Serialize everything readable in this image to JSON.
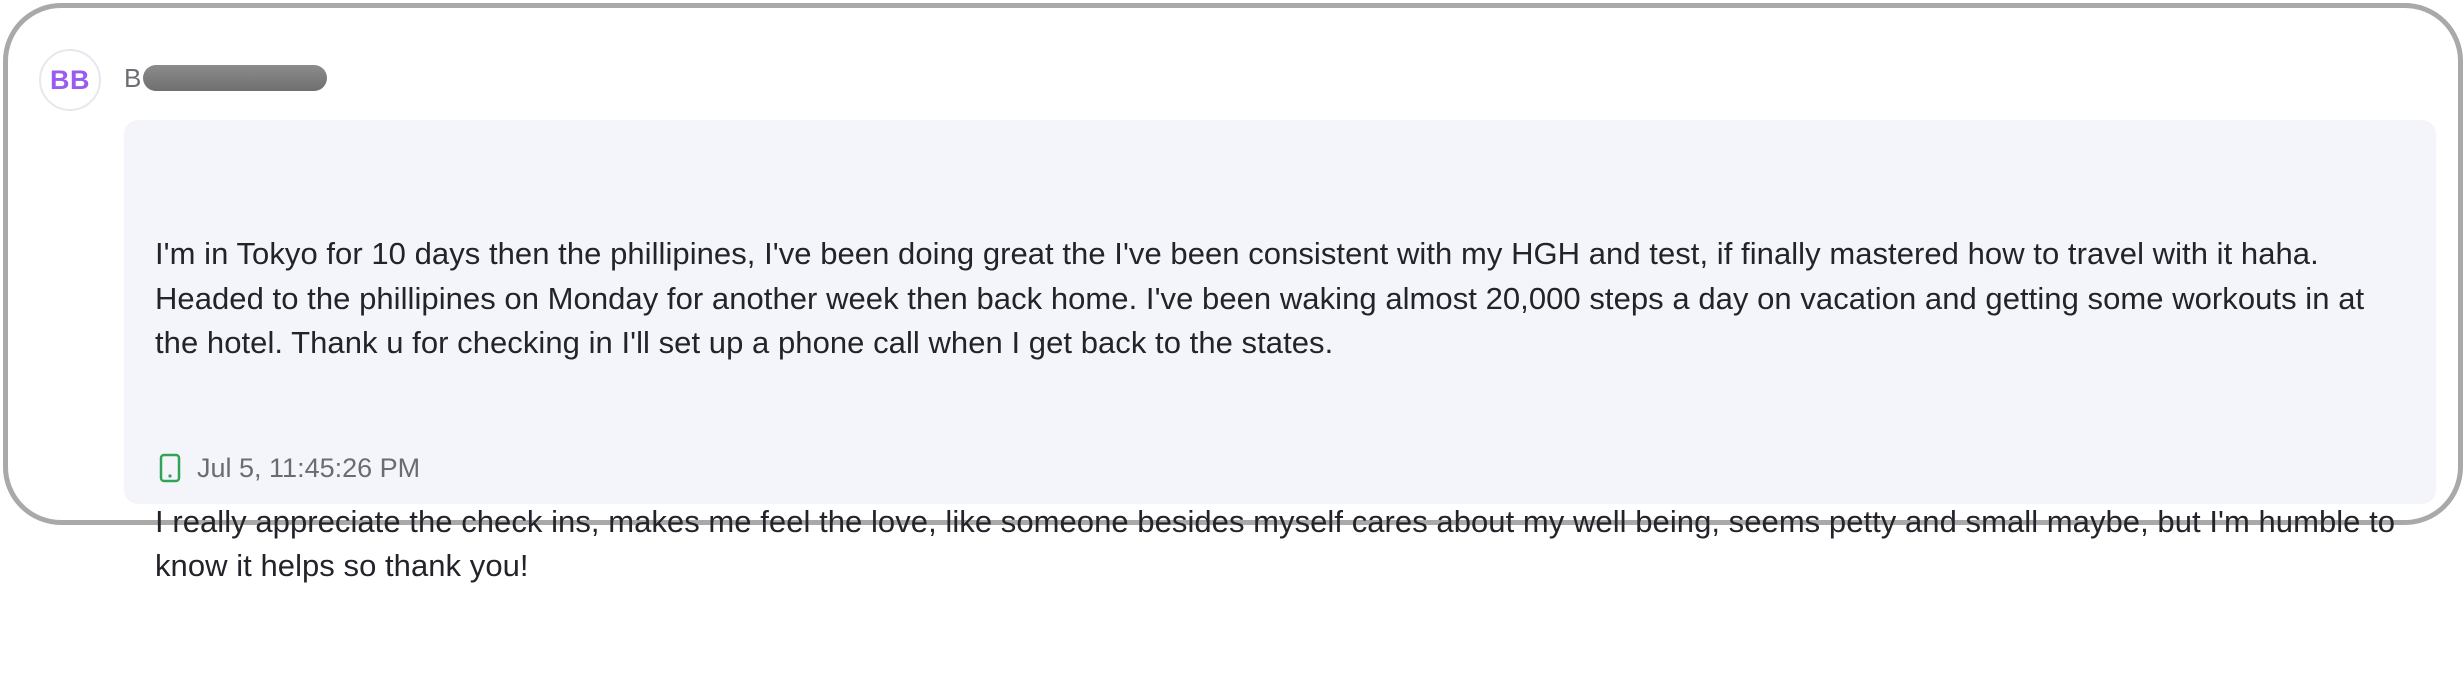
{
  "sender": {
    "initials": "BB",
    "name_visible": "B"
  },
  "message": {
    "paragraphs": [
      "I'm in Tokyo for 10 days then the phillipines, I've been doing great the I've been consistent with my HGH and test, if finally mastered how to travel with it haha. Headed to the phillipines on Monday for another week then back home. I've been waking almost 20,000 steps a day on vacation and getting some workouts in at the hotel. Thank u for checking in I'll set up a phone call when I get back to the states.",
      "I really appreciate the check ins, makes me feel the love, like someone besides myself cares about my well being, seems petty and small maybe, but I'm humble to know it helps so thank you!"
    ],
    "timestamp": "Jul 5, 11:45:26 PM",
    "channel_icon": "mobile-phone-icon"
  },
  "colors": {
    "avatar_text": "#9a5cf0",
    "bubble_background": "#f4f5fa",
    "phone_icon": "#31a354",
    "frame_border": "#a9a9a9"
  }
}
